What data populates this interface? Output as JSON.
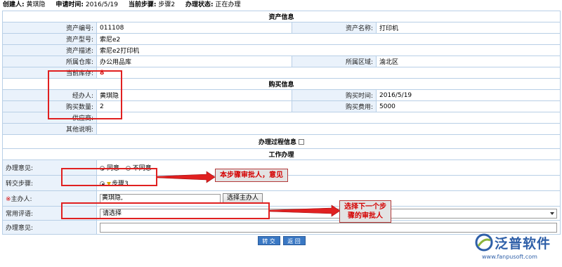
{
  "header": {
    "creator_label": "创建人:",
    "creator": "黄琪隐",
    "apply_time_label": "申请时间:",
    "apply_time": "2016/5/19",
    "current_step_label": "当前步骤:",
    "current_step": "步骤2",
    "status_label": "办理状态:",
    "status": "正在办理"
  },
  "asset_section": {
    "title": "资产信息",
    "asset_no_label": "资产编号:",
    "asset_no": "011108",
    "asset_name_label": "资产名称:",
    "asset_name": "打印机",
    "asset_model_label": "资产型号:",
    "asset_model": "索尼e2",
    "asset_desc_label": "资产描述:",
    "asset_desc": "索尼e2打印机",
    "warehouse_label": "所属仓库:",
    "warehouse": "办公用品库",
    "region_label": "所属区域:",
    "region": "渝北区",
    "stock_label": "当前库存:",
    "stock": "8"
  },
  "purchase_section": {
    "title": "购买信息",
    "handler_label": "经办人:",
    "handler": "黄琪隐",
    "purchase_time_label": "购买时间:",
    "purchase_time": "2016/5/19",
    "quantity_label": "购买数量:",
    "quantity": "2",
    "cost_label": "购买费用:",
    "cost": "5000",
    "supplier_label": "供应商:",
    "supplier": "",
    "other_label": "其他说明:",
    "other": ""
  },
  "process": {
    "info_label": "办理过程信息"
  },
  "work": {
    "title": "工作办理",
    "opinion_label": "办理意见:",
    "agree_label": "同意",
    "disagree_label": "不同意",
    "transfer_label": "转交步骤:",
    "transfer_step": "步骤3",
    "host_required_mark": "※",
    "host_label": "主办人:",
    "host_value": "黄琪隐,",
    "choose_host_button": "选择主办人",
    "common_phrase_label": "常用评语:",
    "common_phrase_value": "请选择",
    "opinion2_label": "办理意见:"
  },
  "buttons": {
    "submit": "转 交",
    "back": "返 回"
  },
  "annotations": {
    "callout1": "本步骤审批人，意见",
    "callout2_line1": "选择下一个步",
    "callout2_line2": "骤的审批人"
  },
  "logo": {
    "brand": "泛普软件",
    "url": "www.fanpusoft.com"
  }
}
